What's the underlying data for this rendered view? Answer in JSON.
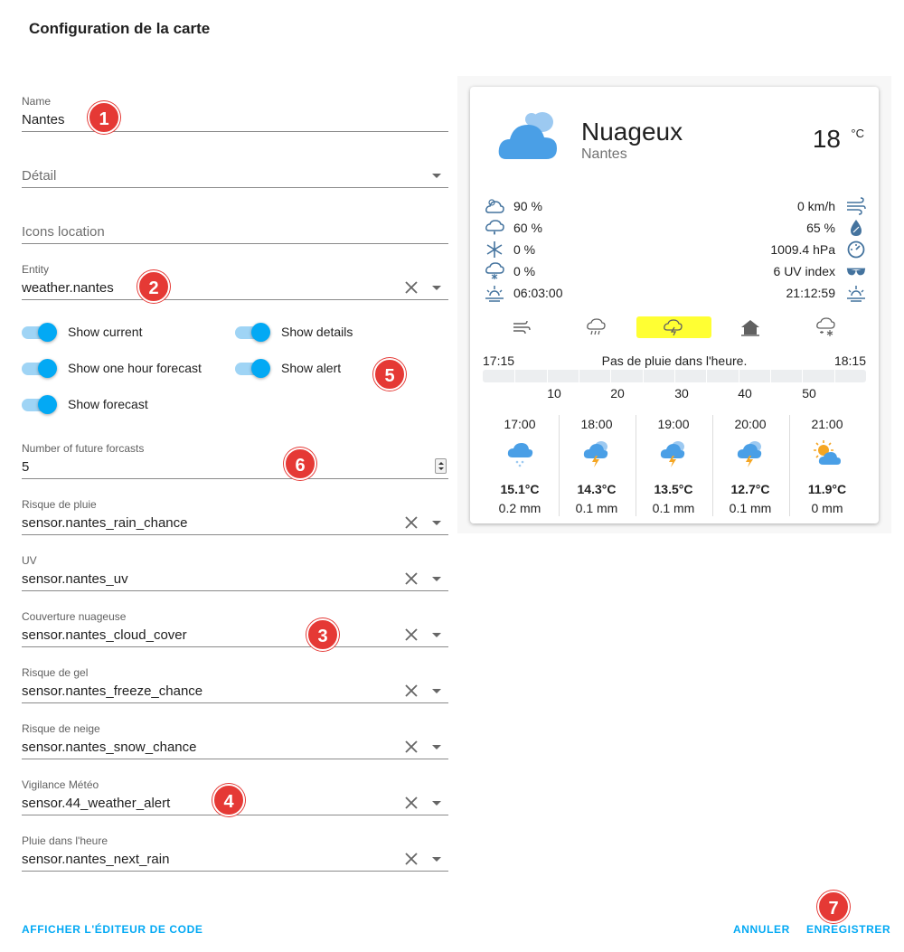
{
  "dialog": {
    "title": "Configuration de la carte",
    "show_code_editor": "AFFICHER L'ÉDITEUR DE CODE",
    "cancel": "ANNULER",
    "save": "ENREGISTRER"
  },
  "form": {
    "name": {
      "label": "Name",
      "value": "Nantes"
    },
    "detail": {
      "placeholder": "Détail"
    },
    "icons_location": {
      "placeholder": "Icons location"
    },
    "entity": {
      "label": "Entity",
      "value": "weather.nantes"
    },
    "toggles": {
      "show_current": {
        "label": "Show current",
        "on": true
      },
      "show_details": {
        "label": "Show details",
        "on": true
      },
      "show_one_hour": {
        "label": "Show one hour forecast",
        "on": true
      },
      "show_alert": {
        "label": "Show alert",
        "on": true
      },
      "show_forecast": {
        "label": "Show forecast",
        "on": true
      }
    },
    "future_forecasts": {
      "label": "Number of future forcasts",
      "value": "5"
    },
    "rain_chance": {
      "label": "Risque de pluie",
      "value": "sensor.nantes_rain_chance"
    },
    "uv": {
      "label": "UV",
      "value": "sensor.nantes_uv"
    },
    "cloud_cover": {
      "label": "Couverture nuageuse",
      "value": "sensor.nantes_cloud_cover"
    },
    "freeze_chance": {
      "label": "Risque de gel",
      "value": "sensor.nantes_freeze_chance"
    },
    "snow_chance": {
      "label": "Risque de neige",
      "value": "sensor.nantes_snow_chance"
    },
    "weather_alert": {
      "label": "Vigilance Météo",
      "value": "sensor.44_weather_alert"
    },
    "next_rain": {
      "label": "Pluie dans l'heure",
      "value": "sensor.nantes_next_rain"
    }
  },
  "badges": [
    "1",
    "2",
    "3",
    "4",
    "5",
    "6",
    "7"
  ],
  "preview": {
    "condition": "Nuageux",
    "city": "Nantes",
    "temperature": "18",
    "unit": "°C",
    "details_left": [
      "90 %",
      "60 %",
      "0 %",
      "0 %",
      "06:03:00"
    ],
    "details_right": [
      "0 km/h",
      "65 %",
      "1009.4 hPa",
      "6 UV index",
      "21:12:59"
    ],
    "icons_left": [
      "cloud-cover-icon",
      "rain-chance-icon",
      "freeze-icon",
      "snow-chance-icon",
      "sunrise-icon"
    ],
    "icons_right": [
      "wind-icon",
      "humidity-icon",
      "pressure-icon",
      "sunglasses-icon",
      "sunset-icon"
    ],
    "tabs": [
      "wind-tab-icon",
      "rain-tab-icon",
      "storm-tab-icon",
      "home-alert-tab-icon",
      "snow-tab-icon"
    ],
    "active_tab": 2,
    "accent": "#ffff33",
    "rain": {
      "start": "17:15",
      "message": "Pas de pluie dans l'heure.",
      "end": "18:15",
      "ticks": [
        "10",
        "20",
        "30",
        "40",
        "50"
      ]
    },
    "forecast": [
      {
        "time": "17:00",
        "icon": "snow-cloud-icon",
        "temp": "15.1°C",
        "rain": "0.2 mm"
      },
      {
        "time": "18:00",
        "icon": "thunderstorm-icon",
        "temp": "14.3°C",
        "rain": "0.1 mm"
      },
      {
        "time": "19:00",
        "icon": "thunderstorm-icon",
        "temp": "13.5°C",
        "rain": "0.1 mm"
      },
      {
        "time": "20:00",
        "icon": "thunderstorm-icon",
        "temp": "12.7°C",
        "rain": "0.1 mm"
      },
      {
        "time": "21:00",
        "icon": "partly-sunny-icon",
        "temp": "11.9°C",
        "rain": "0 mm"
      }
    ]
  }
}
